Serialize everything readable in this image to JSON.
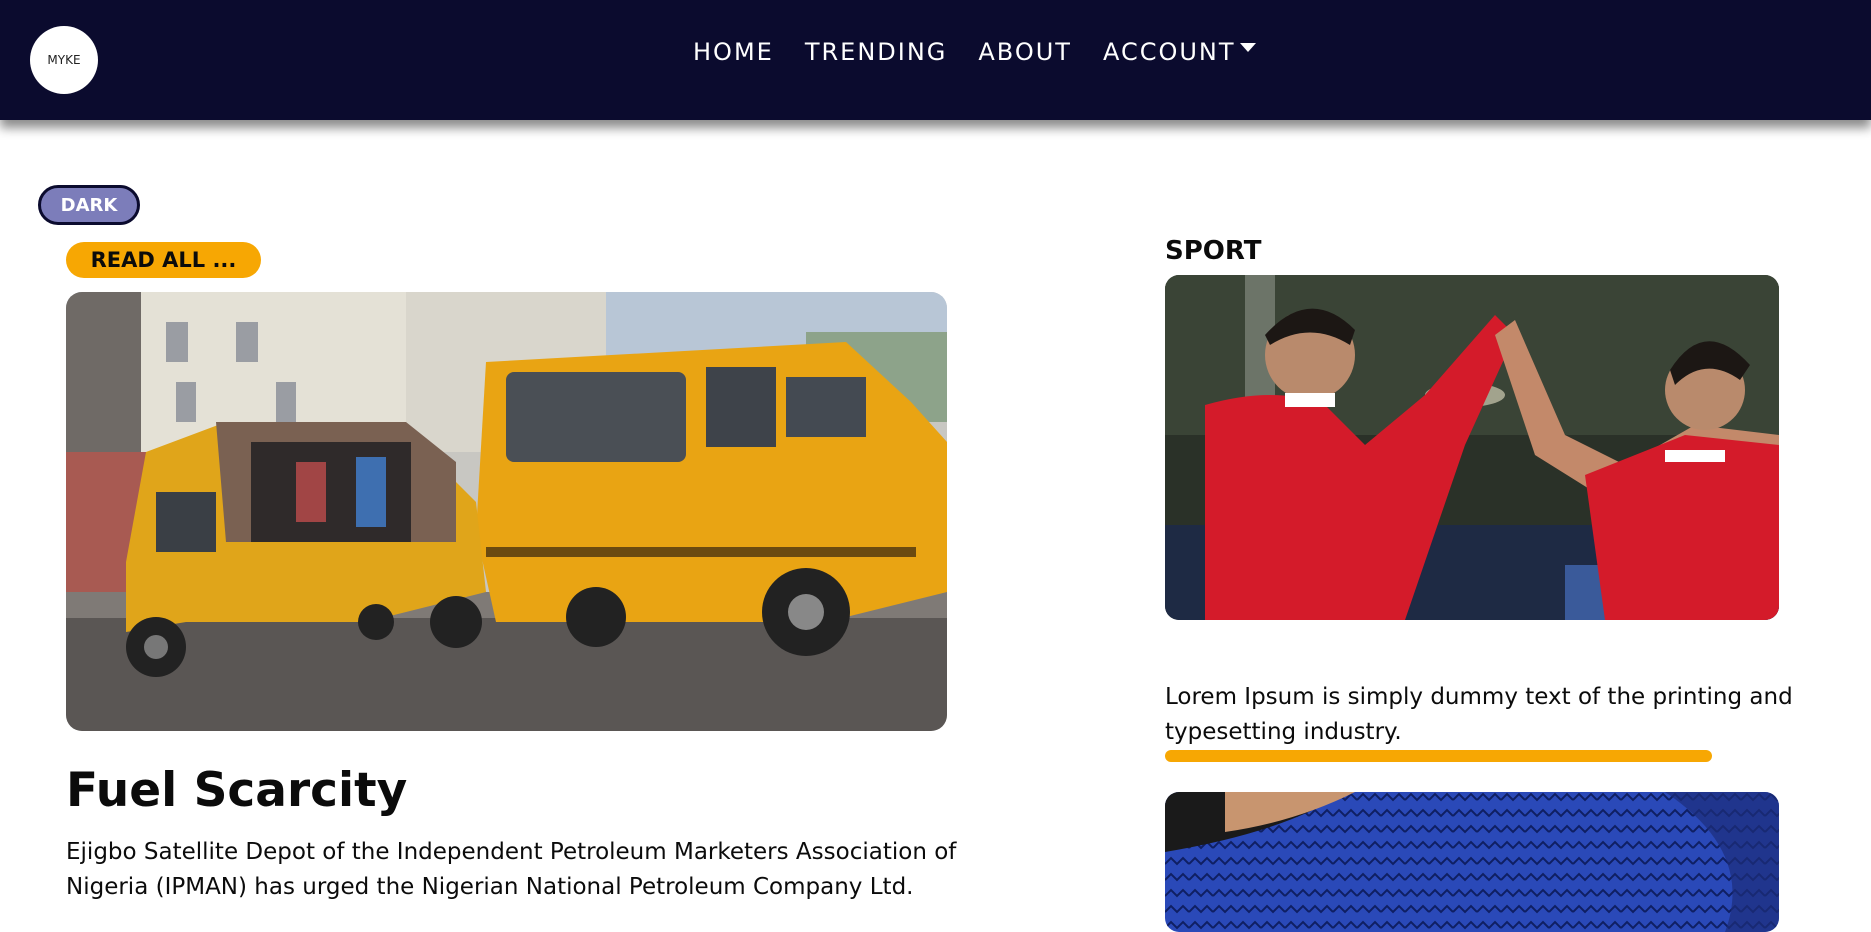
{
  "header": {
    "logo_text": "MYKE",
    "nav": [
      {
        "label": "HOME"
      },
      {
        "label": "TRENDING"
      },
      {
        "label": "ABOUT"
      },
      {
        "label": "ACCOUNT"
      }
    ]
  },
  "theme_toggle": {
    "label": "DARK"
  },
  "main": {
    "read_all_label": "READ ALL ...",
    "title": "Fuel Scarcity",
    "description": "Ejigbo Satellite Depot of the Independent Petroleum Marketers Association of Nigeria (IPMAN) has urged the Nigerian National Petroleum Company Ltd."
  },
  "sidebar": {
    "section_title": "SPORT",
    "caption": "Lorem Ipsum is simply dummy text of the printing and typesetting industry.",
    "progress_fraction": 1.0
  },
  "colors": {
    "navbar": "#0b0b2e",
    "accent": "#f7a703",
    "toggle": "#7c7dba"
  }
}
